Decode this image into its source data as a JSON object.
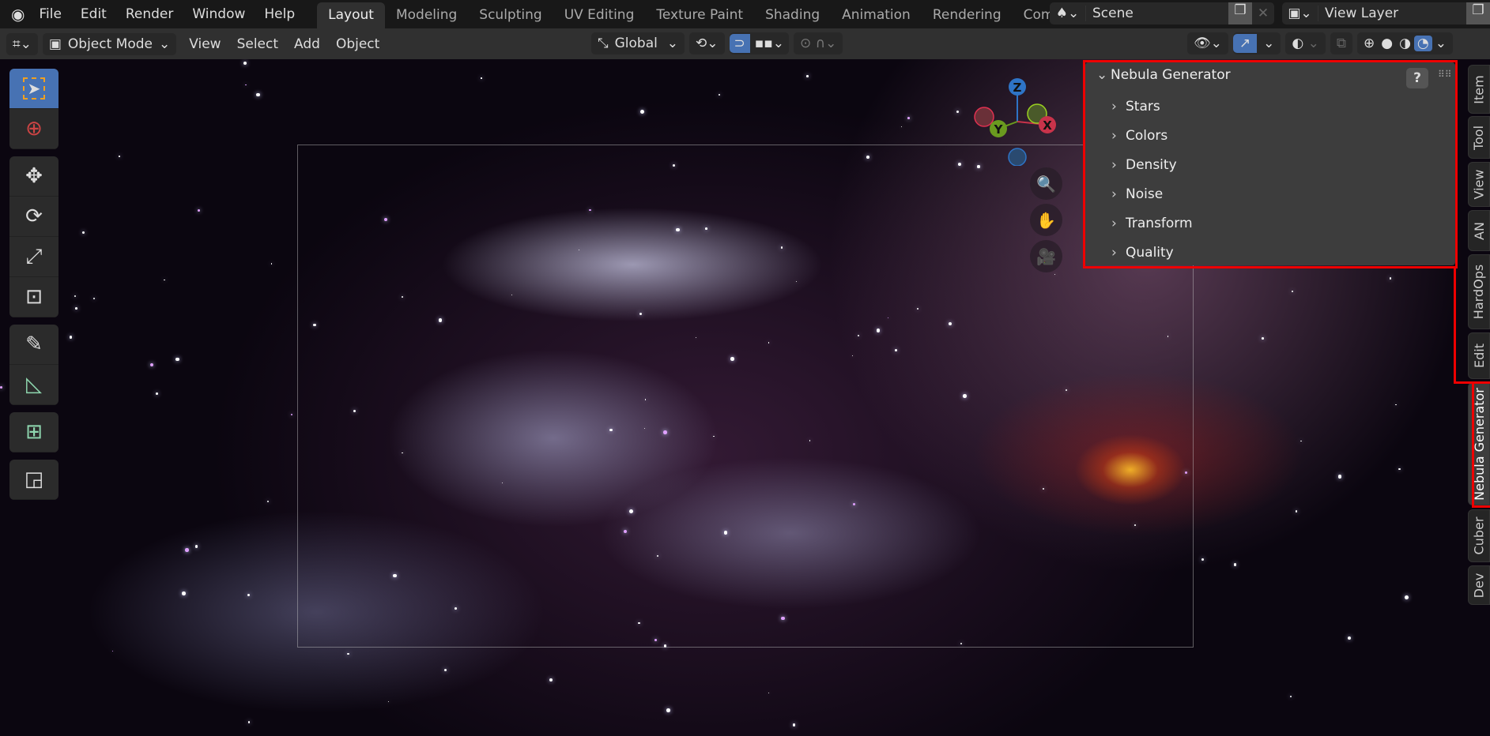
{
  "topbar": {
    "menus": [
      "File",
      "Edit",
      "Render",
      "Window",
      "Help"
    ],
    "workspaces": [
      "Layout",
      "Modeling",
      "Sculpting",
      "UV Editing",
      "Texture Paint",
      "Shading",
      "Animation",
      "Rendering",
      "Compo"
    ],
    "scene": "Scene",
    "view_layer": "View Layer"
  },
  "header": {
    "mode": "Object Mode",
    "menus": [
      "View",
      "Select",
      "Add",
      "Object"
    ],
    "orientation": "Global"
  },
  "gizmo": {
    "z": "Z",
    "y": "Y",
    "x": "X"
  },
  "panel": {
    "title": "Nebula Generator",
    "subpanels": [
      "Stars",
      "Colors",
      "Density",
      "Noise",
      "Transform",
      "Quality"
    ]
  },
  "tabs": [
    "Item",
    "Tool",
    "View",
    "AN",
    "HardOps",
    "Edit",
    "Nebula Generator",
    "Cuber",
    "Dev"
  ],
  "colors": {
    "accent": "#4772b3",
    "highlight": "#ff0000",
    "x_axis": "#c8334a",
    "y_axis": "#6a9a1f",
    "z_axis": "#2e74c6"
  }
}
